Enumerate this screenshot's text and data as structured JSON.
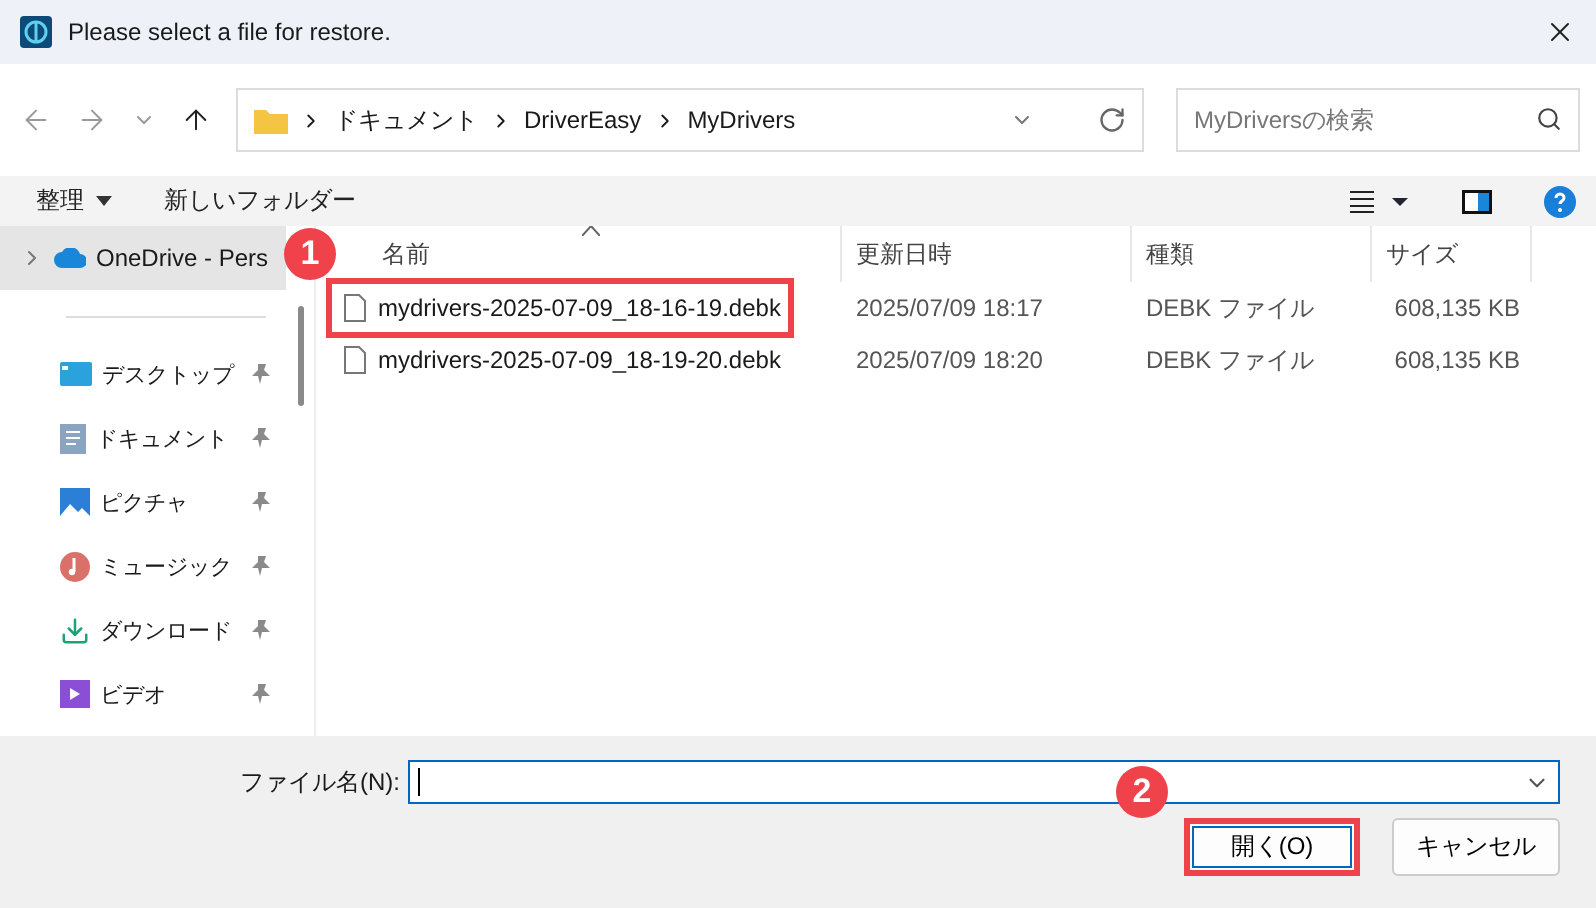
{
  "window": {
    "title": "Please select a file for restore."
  },
  "address": {
    "path": [
      "ドキュメント",
      "DriverEasy",
      "MyDrivers"
    ]
  },
  "search": {
    "placeholder": "MyDriversの検索"
  },
  "toolbar": {
    "organize": "整理",
    "new_folder": "新しいフォルダー"
  },
  "sidebar": {
    "items": [
      {
        "label": "OneDrive - Pers",
        "kind": "cloud",
        "selected": true,
        "pinned": false
      },
      {
        "label": "デスクトップ",
        "kind": "desktop",
        "selected": false,
        "pinned": true
      },
      {
        "label": "ドキュメント",
        "kind": "documents",
        "selected": false,
        "pinned": true
      },
      {
        "label": "ピクチャ",
        "kind": "pictures",
        "selected": false,
        "pinned": true
      },
      {
        "label": "ミュージック",
        "kind": "music",
        "selected": false,
        "pinned": true
      },
      {
        "label": "ダウンロード",
        "kind": "downloads",
        "selected": false,
        "pinned": true
      },
      {
        "label": "ビデオ",
        "kind": "videos",
        "selected": false,
        "pinned": true
      }
    ]
  },
  "table": {
    "columns": [
      "名前",
      "更新日時",
      "種類",
      "サイズ"
    ],
    "rows": [
      {
        "name": "mydrivers-2025-07-09_18-16-19.debk",
        "modified": "2025/07/09 18:17",
        "type": "DEBK ファイル",
        "size": "608,135 KB",
        "annotated": true,
        "step": "1"
      },
      {
        "name": "mydrivers-2025-07-09_18-19-20.debk",
        "modified": "2025/07/09 18:20",
        "type": "DEBK ファイル",
        "size": "608,135 KB",
        "annotated": false
      }
    ]
  },
  "footer": {
    "filename_label": "ファイル名(N):",
    "buttons": [
      {
        "label": "開く(O)",
        "kind": "primary",
        "annotated": true,
        "step": "2"
      },
      {
        "label": "キャンセル",
        "kind": "secondary",
        "annotated": false
      }
    ]
  }
}
